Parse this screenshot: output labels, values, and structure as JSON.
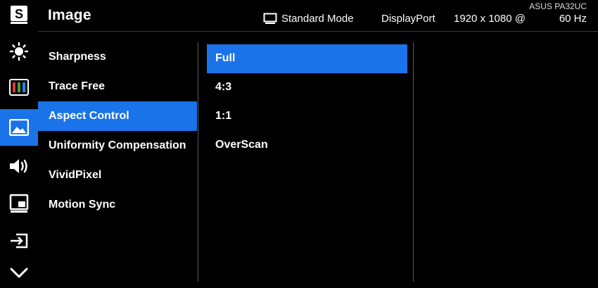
{
  "header": {
    "title": "Image",
    "model": "ASUS PA32UC",
    "mode": "Standard Mode",
    "input": "DisplayPort",
    "resolution": "1920 x 1080 @",
    "refresh": "60 Hz"
  },
  "rail": {
    "items": [
      {
        "icon": "splendid-s-icon"
      },
      {
        "icon": "brightness-icon"
      },
      {
        "icon": "color-bars-icon"
      },
      {
        "icon": "image-icon",
        "active": true
      },
      {
        "icon": "speaker-icon"
      },
      {
        "icon": "pip-icon"
      },
      {
        "icon": "input-select-icon"
      },
      {
        "icon": "chevron-down-icon"
      }
    ]
  },
  "menu": {
    "items": [
      {
        "label": "Sharpness"
      },
      {
        "label": "Trace Free"
      },
      {
        "label": "Aspect Control",
        "active": true
      },
      {
        "label": "Uniformity Compensation"
      },
      {
        "label": "VividPixel"
      },
      {
        "label": "Motion Sync"
      }
    ]
  },
  "options": {
    "items": [
      {
        "label": "Full",
        "active": true
      },
      {
        "label": "4:3"
      },
      {
        "label": "1:1"
      },
      {
        "label": "OverScan"
      }
    ]
  },
  "colors": {
    "accent": "#1a73e8",
    "background": "#000000",
    "divider": "#5a5a5a"
  }
}
